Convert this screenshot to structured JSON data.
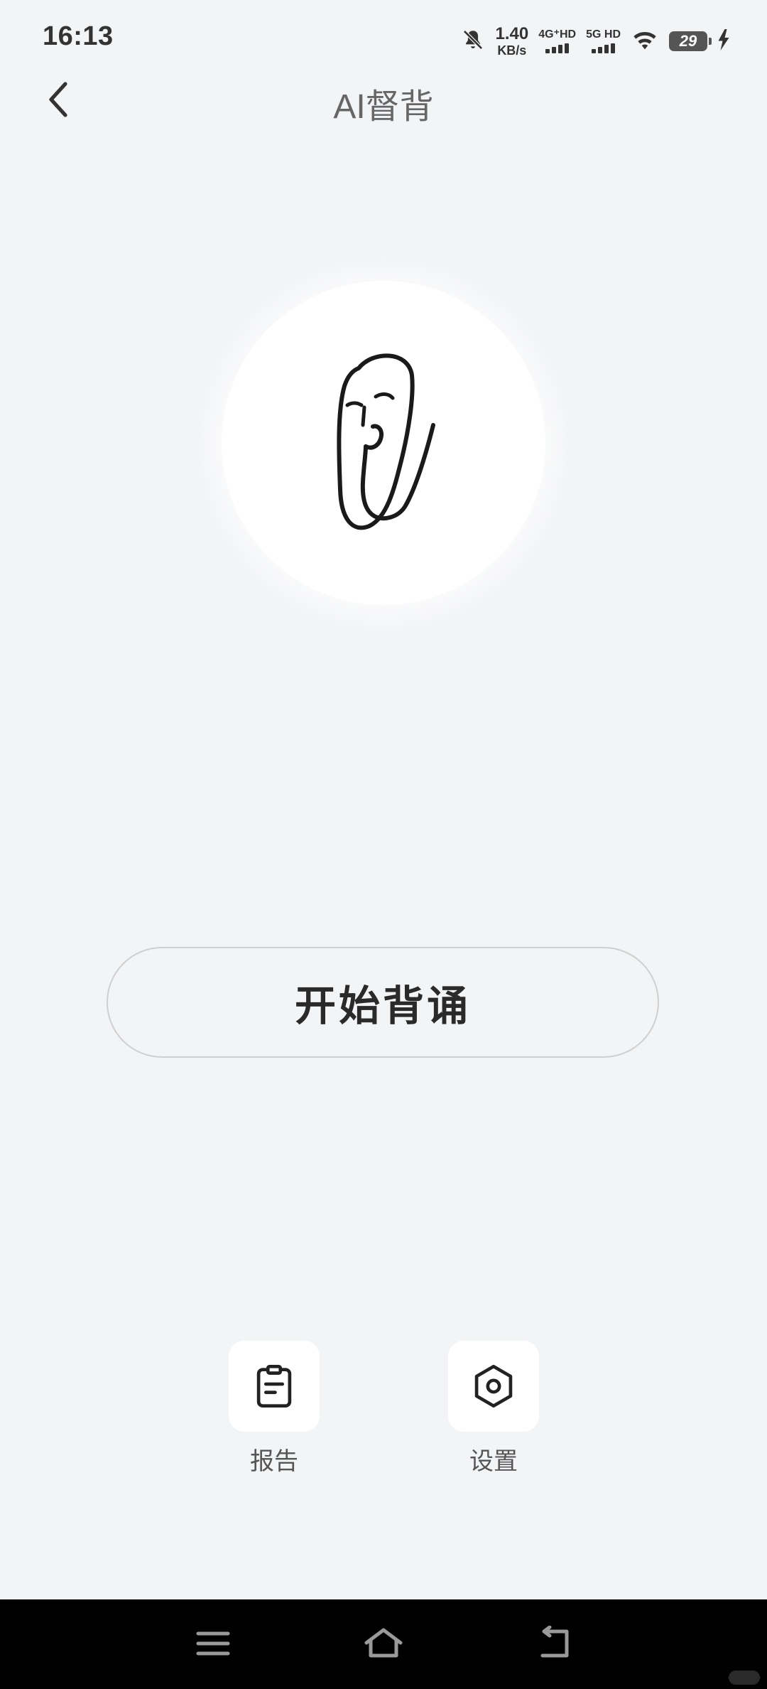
{
  "status_bar": {
    "time": "16:13",
    "net_speed_value": "1.40",
    "net_speed_unit": "KB/s",
    "sim1_label": "4G⁺HD",
    "sim2_label": "5G HD",
    "battery": "29",
    "icons": [
      "mute-bell-icon",
      "wifi-icon",
      "charging-icon"
    ]
  },
  "header": {
    "title": "AI督背",
    "back_icon": "chevron-left-icon"
  },
  "avatar": {
    "icon": "paperclip-face-icon"
  },
  "main": {
    "start_label": "开始背诵"
  },
  "actions": [
    {
      "label": "报告",
      "icon": "clipboard-icon"
    },
    {
      "label": "设置",
      "icon": "hexagon-settings-icon"
    }
  ],
  "nav": {
    "icons": [
      "menu-icon",
      "home-icon",
      "back-icon"
    ]
  },
  "colors": {
    "background": "#f3f4f6",
    "surface": "#ffffff",
    "nav_background": "#000000"
  }
}
